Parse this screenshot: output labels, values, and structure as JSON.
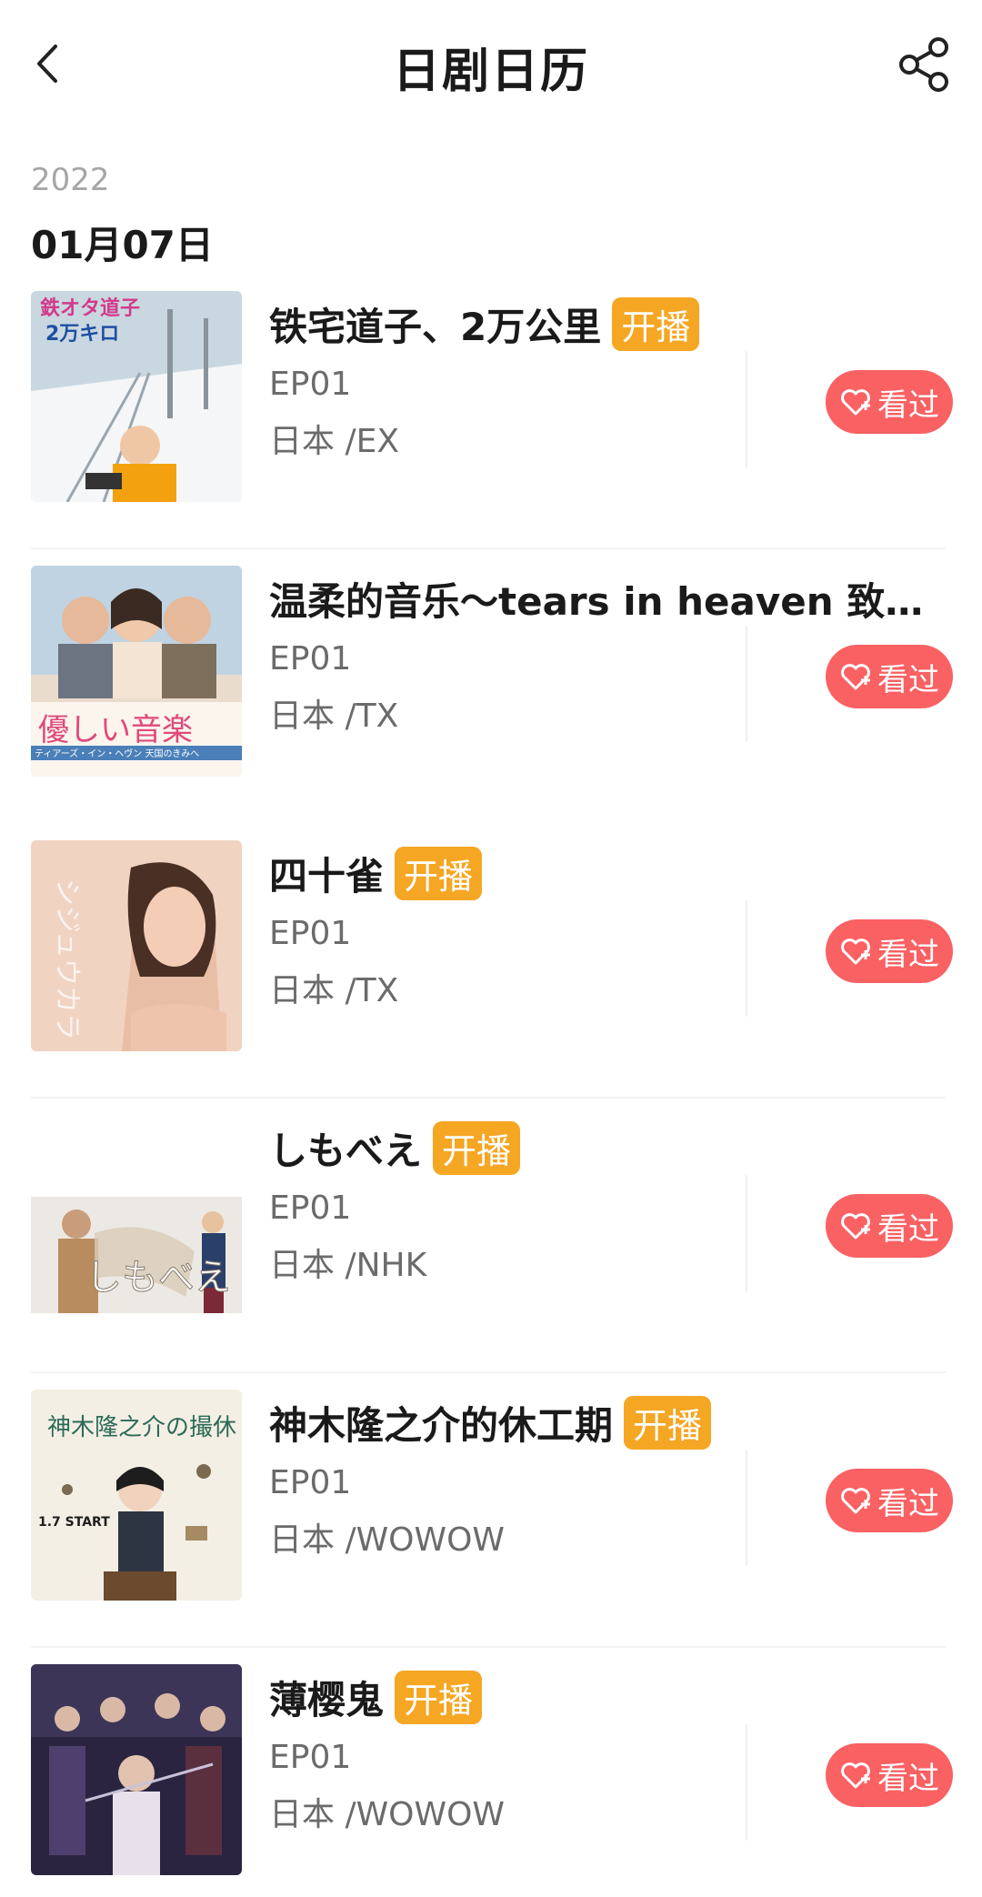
{
  "header": {
    "title": "日剧日历",
    "back_icon": "chevron-left-icon",
    "share_icon": "share-icon"
  },
  "section": {
    "year": "2022",
    "date": "01月07日"
  },
  "accent": {
    "badge": "#f5a623",
    "watched": "#f96163"
  },
  "watched_label": "看过",
  "items": [
    {
      "name": "铁宅道子、2万公里",
      "badge": "开播",
      "ep": "EP01",
      "region": "日本 /EX"
    },
    {
      "name": "温柔的音乐～tears in heaven 致天国...",
      "badge": "",
      "ep": "EP01",
      "region": "日本 /TX"
    },
    {
      "name": "四十雀",
      "badge": "开播",
      "ep": "EP01",
      "region": "日本 /TX"
    },
    {
      "name": "しもべえ",
      "badge": "开播",
      "ep": "EP01",
      "region": "日本 /NHK"
    },
    {
      "name": "神木隆之介的休工期",
      "badge": "开播",
      "ep": "EP01",
      "region": "日本 /WOWOW"
    },
    {
      "name": "薄樱鬼",
      "badge": "开播",
      "ep": "EP01",
      "region": "日本 /WOWOW"
    }
  ],
  "poster_text": [
    {
      "line1": "鉄オタ道子",
      "line2": "2万キロ"
    },
    {
      "line1": "優しい音楽",
      "line2": "ティアーズ・イン・ヘヴン 天国のきみへ"
    },
    {
      "line1": "シジュウカラ",
      "line2": ""
    },
    {
      "line1": "しもべえ",
      "line2": ""
    },
    {
      "line1": "神木隆之介の撮休",
      "line2": "1.7 START"
    },
    {
      "line1": "",
      "line2": ""
    }
  ]
}
